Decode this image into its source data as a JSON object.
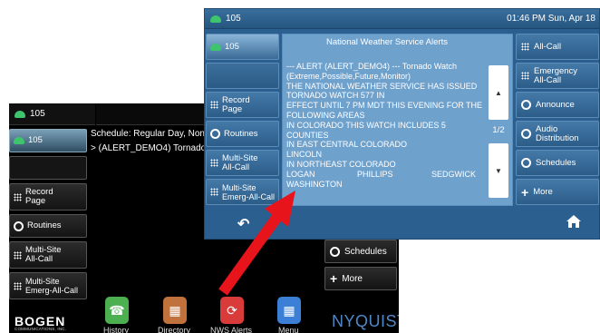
{
  "back": {
    "header": {
      "line": "105"
    },
    "left_buttons": [
      {
        "label": "105",
        "icon": "phone-icon",
        "type": "line"
      },
      {
        "label": "",
        "icon": "",
        "type": "empty"
      },
      {
        "label": "Record Page",
        "icon": "grid-icon",
        "type": "key"
      },
      {
        "label": "Routines",
        "icon": "routine-icon",
        "type": "key"
      },
      {
        "label": "Multi-Site All-Call",
        "icon": "grid-icon",
        "type": "key"
      },
      {
        "label": "Multi-Site Emerg-All-Call",
        "icon": "grid-icon",
        "type": "key"
      }
    ],
    "schedule_line1": "Schedule: Regular Day, None",
    "schedule_line2": "> (ALERT_DEMO4) Tornado",
    "right_buttons": [
      {
        "label": "Schedules",
        "icon": "routine-icon"
      },
      {
        "label": "More",
        "icon": "plus-icon"
      }
    ],
    "dock": [
      {
        "label": "History",
        "icon": "history-icon",
        "color": "#4caf50"
      },
      {
        "label": "Directory",
        "icon": "directory-icon",
        "color": "#c0713c"
      },
      {
        "label": "NWS Alerts",
        "icon": "nws-alerts-icon",
        "color": "#d93a3a"
      },
      {
        "label": "Menu",
        "icon": "menu-icon",
        "color": "#3b7fd6"
      }
    ],
    "brand_left": "BOGEN",
    "brand_left_sub": "COMMUNICATIONS, INC.",
    "brand_right": "NYQUIST"
  },
  "front": {
    "header": {
      "line": "105",
      "datetime": "01:46 PM Sun, Apr 18"
    },
    "left_buttons": [
      {
        "label": "105",
        "icon": "phone-icon",
        "type": "line"
      },
      {
        "label": "",
        "icon": "",
        "type": "empty"
      },
      {
        "label": "Record Page",
        "icon": "grid-icon",
        "type": "key"
      },
      {
        "label": "Routines",
        "icon": "routine-icon",
        "type": "key"
      },
      {
        "label": "Multi-Site All-Call",
        "icon": "grid-icon",
        "type": "key"
      },
      {
        "label": "Multi-Site Emerg-All-Call",
        "icon": "grid-icon",
        "type": "key"
      }
    ],
    "right_buttons": [
      {
        "label": "All-Call",
        "icon": "grid-icon"
      },
      {
        "label": "Emergency All-Call",
        "icon": "grid-icon"
      },
      {
        "label": "Announce",
        "icon": "routine-icon"
      },
      {
        "label": "Audio Distribution",
        "icon": "routine-icon"
      },
      {
        "label": "Schedules",
        "icon": "routine-icon"
      },
      {
        "label": "More",
        "icon": "plus-icon"
      }
    ],
    "alert": {
      "title": "National Weather Service Alerts",
      "lines": [
        "--- ALERT (ALERT_DEMO4) --- Tornado Watch",
        "(Extreme,Possible,Future,Monitor)",
        "THE NATIONAL WEATHER SERVICE HAS ISSUED",
        "TORNADO WATCH 577 IN",
        "EFFECT UNTIL 7 PM MDT THIS EVENING FOR THE",
        "FOLLOWING AREAS",
        "IN COLORADO THIS WATCH INCLUDES 5",
        "COUNTIES",
        "IN EAST CENTRAL COLORADO",
        "LINCOLN",
        "IN NORTHEAST COLORADO"
      ],
      "county_row": [
        "LOGAN",
        "PHILLIPS",
        "SEDGWICK"
      ],
      "last_line": "WASHINGTON",
      "page_indicator": "1/2",
      "up_glyph": "▲",
      "down_glyph": "▼"
    },
    "back_glyph": "↶",
    "home_icon": "home-icon"
  },
  "colors": {
    "front_bg": "#2a5f8f",
    "panel_bg": "#6fa1cd",
    "arrow": "#e8141c",
    "phone_green": "#3ec46d"
  }
}
